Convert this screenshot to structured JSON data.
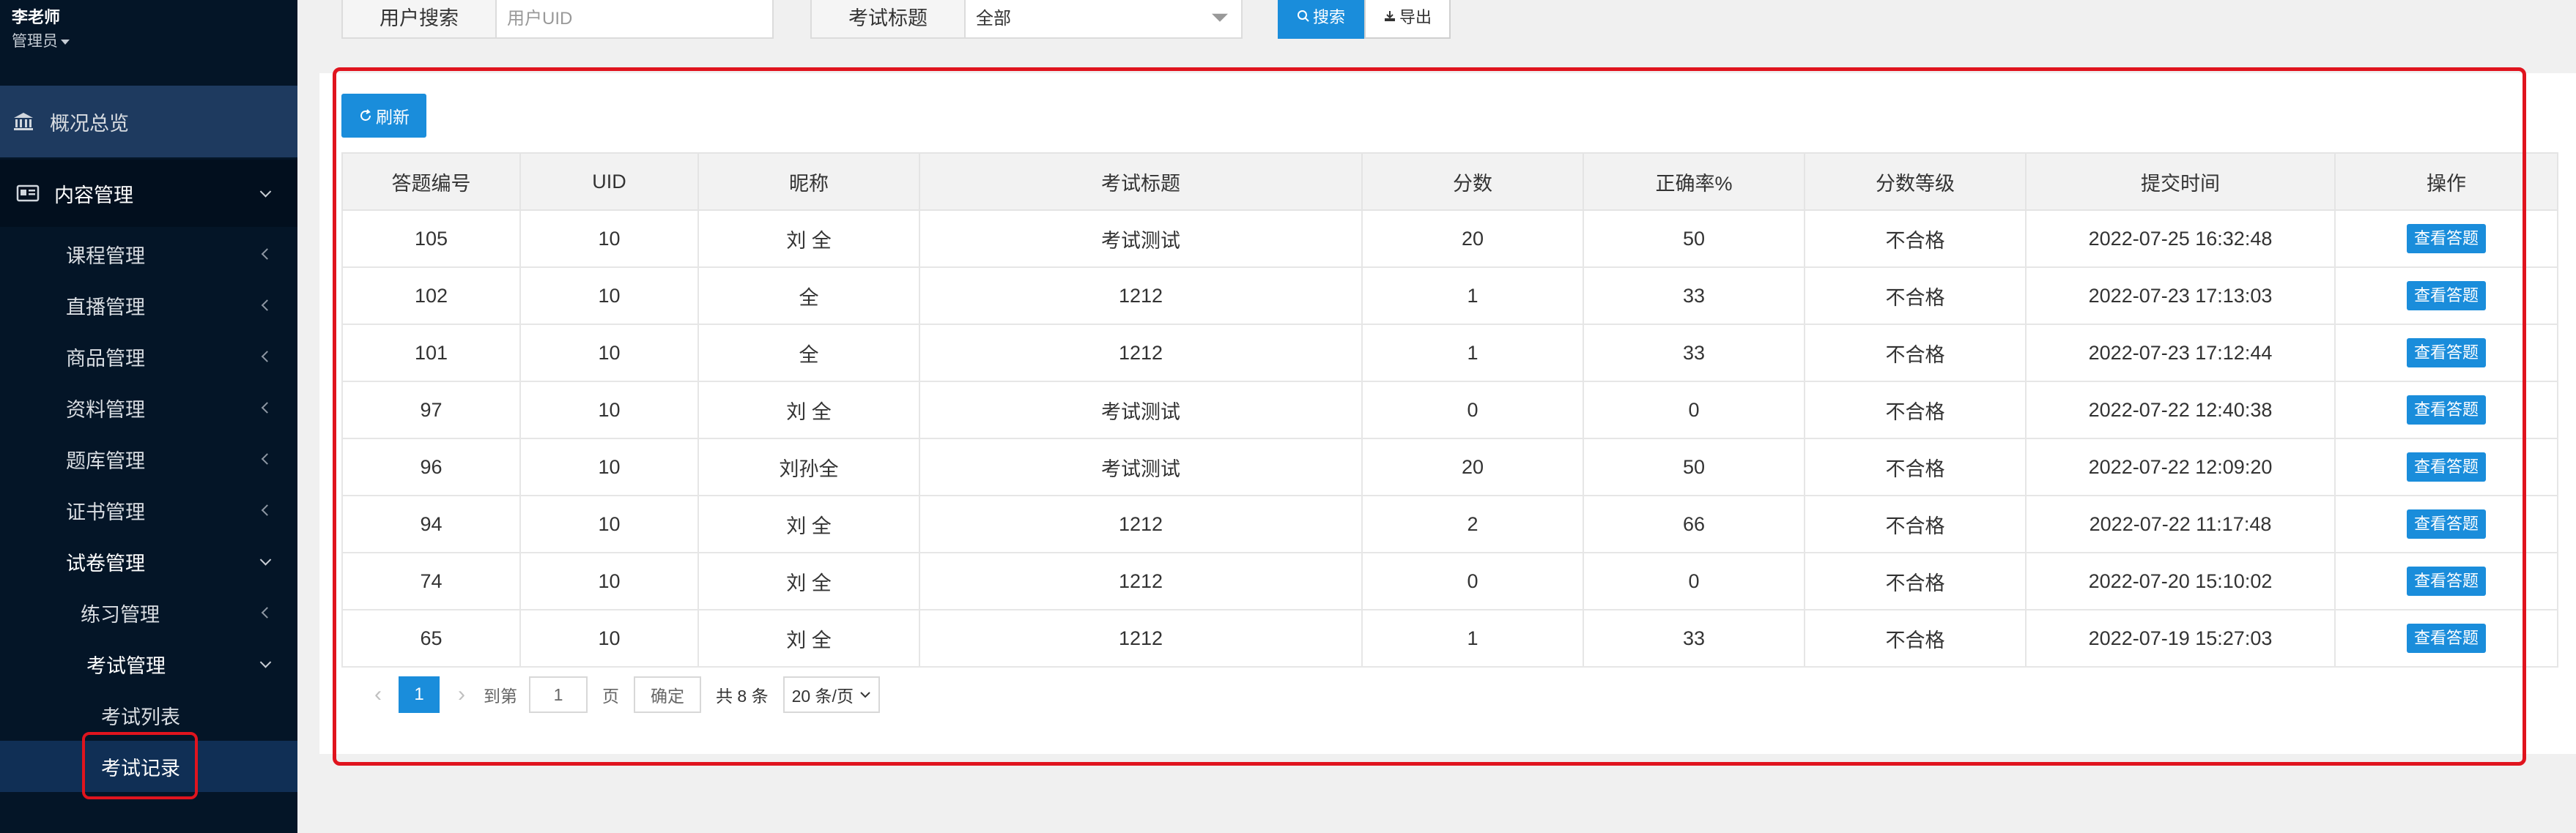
{
  "user": {
    "name": "李老师",
    "role": "管理员"
  },
  "sidebar": {
    "overview": "概况总览",
    "content_mgmt": "内容管理",
    "items": [
      "课程管理",
      "直播管理",
      "商品管理",
      "资料管理",
      "题库管理",
      "证书管理"
    ],
    "exam_paper_mgmt": "试卷管理",
    "practice_mgmt": "练习管理",
    "exam_mgmt": "考试管理",
    "exam_list": "考试列表",
    "exam_records": "考试记录"
  },
  "search": {
    "user_label": "用户搜索",
    "user_placeholder": "用户UID",
    "title_label": "考试标题",
    "title_value": "全部",
    "search_btn": "搜索",
    "export_btn": "导出"
  },
  "refresh_btn": "刷新",
  "table": {
    "headers": [
      "答题编号",
      "UID",
      "昵称",
      "考试标题",
      "分数",
      "正确率%",
      "分数等级",
      "提交时间",
      "操作"
    ],
    "action_label": "查看答题",
    "rows": [
      {
        "id": "105",
        "uid": "10",
        "nick": "刘 全",
        "title": "考试测试",
        "score": "20",
        "rate": "50",
        "grade": "不合格",
        "time": "2022-07-25 16:32:48"
      },
      {
        "id": "102",
        "uid": "10",
        "nick": " 全",
        "title": "1212",
        "score": "1",
        "rate": "33",
        "grade": "不合格",
        "time": "2022-07-23 17:13:03"
      },
      {
        "id": "101",
        "uid": "10",
        "nick": " 全",
        "title": "1212",
        "score": "1",
        "rate": "33",
        "grade": "不合格",
        "time": "2022-07-23 17:12:44"
      },
      {
        "id": "97",
        "uid": "10",
        "nick": "刘 全",
        "title": "考试测试",
        "score": "0",
        "rate": "0",
        "grade": "不合格",
        "time": "2022-07-22 12:40:38"
      },
      {
        "id": "96",
        "uid": "10",
        "nick": "刘孙全",
        "title": "考试测试",
        "score": "20",
        "rate": "50",
        "grade": "不合格",
        "time": "2022-07-22 12:09:20"
      },
      {
        "id": "94",
        "uid": "10",
        "nick": "刘 全",
        "title": "1212",
        "score": "2",
        "rate": "66",
        "grade": "不合格",
        "time": "2022-07-22 11:17:48"
      },
      {
        "id": "74",
        "uid": "10",
        "nick": "刘 全",
        "title": "1212",
        "score": "0",
        "rate": "0",
        "grade": "不合格",
        "time": "2022-07-20 15:10:02"
      },
      {
        "id": "65",
        "uid": "10",
        "nick": "刘 全",
        "title": "1212",
        "score": "1",
        "rate": "33",
        "grade": "不合格",
        "time": "2022-07-19 15:27:03"
      }
    ]
  },
  "pager": {
    "current": "1",
    "goto_label": "到第",
    "goto_value": "1",
    "page_label": "页",
    "confirm": "确定",
    "total": "共 8 条",
    "page_size": "20 条/页"
  }
}
